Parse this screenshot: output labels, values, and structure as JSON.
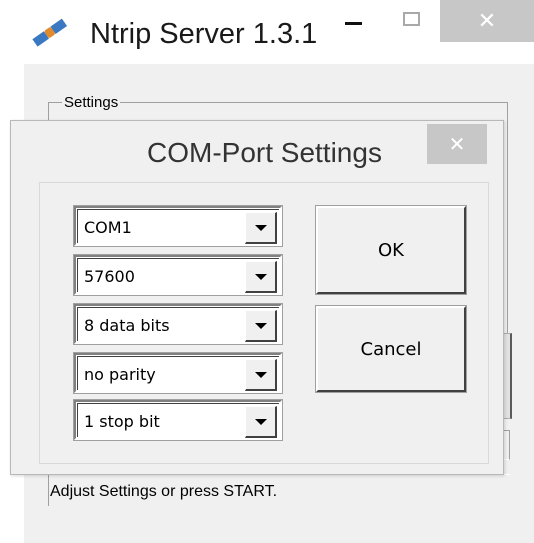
{
  "main_window": {
    "title": "Ntrip Server 1.3.1",
    "settings_group_label": "Settings",
    "status_text": "Adjust Settings or press START."
  },
  "dialog": {
    "title": "COM-Port Settings",
    "port": "COM1",
    "baud_rate": "57600",
    "data_bits": "8 data bits",
    "parity": "no parity",
    "stop_bits": "1 stop bit",
    "ok_label": "OK",
    "cancel_label": "Cancel"
  },
  "icons": {
    "app": "satellite-icon",
    "minimize": "minimize-icon",
    "maximize": "maximize-icon",
    "close": "close-icon",
    "dropdown": "chevron-down-icon"
  },
  "colors": {
    "titlebar_close_bg": "#c7c7c7",
    "client_bg": "#f0f0f0",
    "icon_blue": "#3a78c2",
    "icon_orange": "#e38a2c"
  }
}
